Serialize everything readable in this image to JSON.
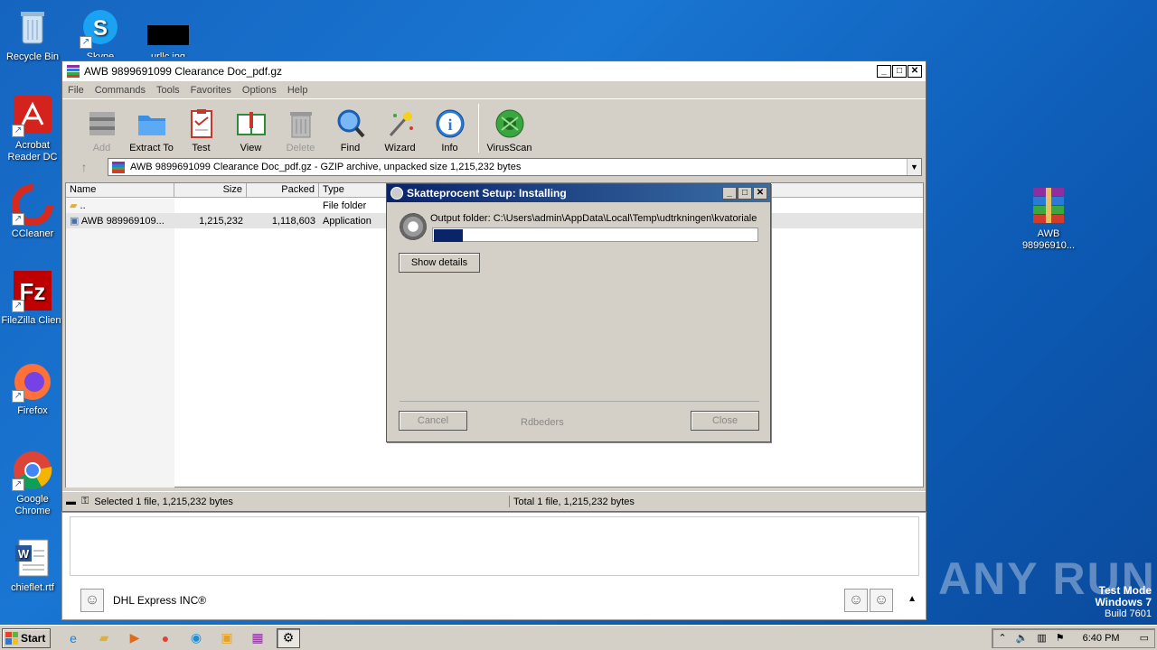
{
  "desktop": {
    "icons": [
      {
        "label": "Recycle Bin"
      },
      {
        "label": "Skype"
      },
      {
        "label": "urllc.jpg"
      },
      {
        "label": "Acrobat Reader DC"
      },
      {
        "label": "CCleaner"
      },
      {
        "label": "FileZilla Client"
      },
      {
        "label": "Firefox"
      },
      {
        "label": "Google Chrome"
      },
      {
        "label": "chieflet.rtf"
      },
      {
        "label": "AWB 98996910..."
      }
    ],
    "watermark": "ANY RUN",
    "testmode": {
      "line1": "Test Mode",
      "line2": "Windows 7",
      "line3": "Build 7601"
    }
  },
  "winrar": {
    "title": "AWB 9899691099 Clearance Doc_pdf.gz",
    "menu": [
      "File",
      "Commands",
      "Tools",
      "Favorites",
      "Options",
      "Help"
    ],
    "toolbar": [
      {
        "label": "Add",
        "icon": "add-archive-icon",
        "enabled": false
      },
      {
        "label": "Extract To",
        "icon": "extract-folder-icon",
        "enabled": true
      },
      {
        "label": "Test",
        "icon": "test-clipboard-icon",
        "enabled": true
      },
      {
        "label": "View",
        "icon": "view-book-icon",
        "enabled": true
      },
      {
        "label": "Delete",
        "icon": "trash-icon",
        "enabled": false
      },
      {
        "label": "Find",
        "icon": "magnifier-icon",
        "enabled": true
      },
      {
        "label": "Wizard",
        "icon": "wand-icon",
        "enabled": true
      },
      {
        "label": "Info",
        "icon": "info-icon",
        "enabled": true
      },
      {
        "label": "VirusScan",
        "icon": "virus-scan-icon",
        "enabled": true
      }
    ],
    "path": "AWB 9899691099 Clearance Doc_pdf.gz - GZIP archive, unpacked size 1,215,232 bytes",
    "columns": [
      "Name",
      "Size",
      "Packed",
      "Type"
    ],
    "rows": [
      {
        "name": "..",
        "size": "",
        "packed": "",
        "type": "File folder"
      },
      {
        "name": "AWB 989969109...",
        "size": "1,215,232",
        "packed": "1,118,603",
        "type": "Application"
      }
    ],
    "status_left": "Selected 1 file, 1,215,232 bytes",
    "status_right": "Total 1 file, 1,215,232 bytes"
  },
  "lower_panel": {
    "sender": "DHL Express INC®"
  },
  "setup": {
    "title": "Skatteprocent Setup: Installing",
    "output_folder": "Output folder: C:\\Users\\admin\\AppData\\Local\\Temp\\udtrkningen\\kvatoriale",
    "progress": 0.09,
    "show_details": "Show details",
    "cancel": "Cancel",
    "brand": "Rdbeders",
    "close": "Close"
  },
  "taskbar": {
    "start": "Start",
    "clock": "6:40 PM"
  },
  "colors": {
    "desktop": "#1976d2",
    "dialog_title": "#0a246a",
    "progress_fill": "#0a246a"
  }
}
